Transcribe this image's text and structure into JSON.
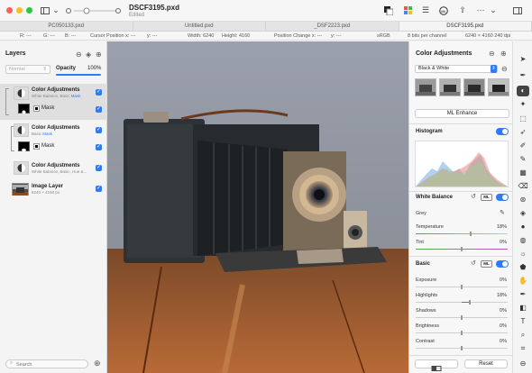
{
  "window": {
    "title": "DSCF3195.pxd",
    "subtitle": "Edited"
  },
  "tabs": [
    "PC050133.pxd",
    "Untitled.pxd",
    "_DSF2223.pxd",
    "DSCF3195.pxd"
  ],
  "info": {
    "r": "R: ---",
    "g": "G: ---",
    "b": "B: ---",
    "cursor_x": "Cursor Position x: ---",
    "cursor_y": "y: ---",
    "width": "Width: 6240",
    "height": "Height: 4160",
    "pos_x": "Position Change x: ---",
    "pos_y": "y: ---",
    "colorspace": "sRGB",
    "depth": "8 bits per channel",
    "size": "6240 × 4160 240 dpi"
  },
  "layers_panel": {
    "title": "Layers",
    "blend_mode": "Normal",
    "opacity_label": "Opacity",
    "opacity_value": "100%",
    "search_placeholder": "Search",
    "layers": [
      {
        "name": "Color Adjustments",
        "sub": "White Balance, Basic",
        "mask_link": "Mask"
      },
      {
        "name": "Mask"
      },
      {
        "name": "Color Adjustments",
        "sub": "Basic",
        "mask_link": "Mask"
      },
      {
        "name": "Mask"
      },
      {
        "name": "Color Adjustments",
        "sub": "White Balance, Basic, Hue &..."
      },
      {
        "name": "Image Layer",
        "sub": "6240 × 4160 px"
      }
    ]
  },
  "adjust_panel": {
    "title": "Color Adjustments",
    "preset": "Black & White",
    "ml_enhance": "ML Enhance",
    "histogram": "Histogram",
    "white_balance": "White Balance",
    "ml_badge": "ML",
    "grey": "Grey",
    "temperature": {
      "label": "Temperature",
      "value": "18%"
    },
    "tint": {
      "label": "Tint",
      "value": "0%"
    },
    "basic": "Basic",
    "exposure": {
      "label": "Exposure",
      "value": "0%"
    },
    "highlights": {
      "label": "Highlights",
      "value": "18%"
    },
    "shadows": {
      "label": "Shadows",
      "value": "0%"
    },
    "brightness": {
      "label": "Brightness",
      "value": "0%"
    },
    "contrast": {
      "label": "Contrast",
      "value": "0%"
    },
    "reset": "Reset"
  },
  "colors": {
    "accent": "#2f7bf5",
    "selected_row": "#dfdfdf"
  }
}
